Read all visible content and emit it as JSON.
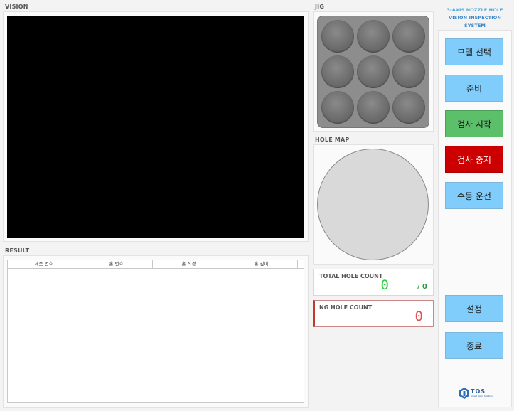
{
  "sections": {
    "vision": "VISION",
    "result": "RESULT",
    "jig": "JIG",
    "hole_map": "HOLE MAP"
  },
  "app_title": {
    "line1": "3-AXIS NOZZLE HOLE",
    "line2": "VISION INSPECTION SYSTEM"
  },
  "result_table": {
    "columns": [
      "제품 번호",
      "홀 번호",
      "홀 직경",
      "홀 깊이"
    ]
  },
  "counts": {
    "total_label": "TOTAL HOLE COUNT",
    "total_value": "0",
    "total_of": "/ 0",
    "ng_label": "NG HOLE COUNT",
    "ng_value": "0"
  },
  "buttons": {
    "select_model": "모델 선택",
    "ready": "준비",
    "start_inspection": "검사 시작",
    "stop_inspection": "검사 중지",
    "manual_operation": "수동 운전",
    "settings": "설정",
    "exit": "종료"
  },
  "logo": {
    "name": "TOS",
    "tagline": "Smart Optic Solution"
  },
  "colors": {
    "button_blue": "#80ccfa",
    "button_green": "#5cbf6a",
    "button_red": "#cc0000",
    "count_green": "#2ecc40",
    "count_red": "#e05050"
  },
  "jig_hole_count": 9
}
